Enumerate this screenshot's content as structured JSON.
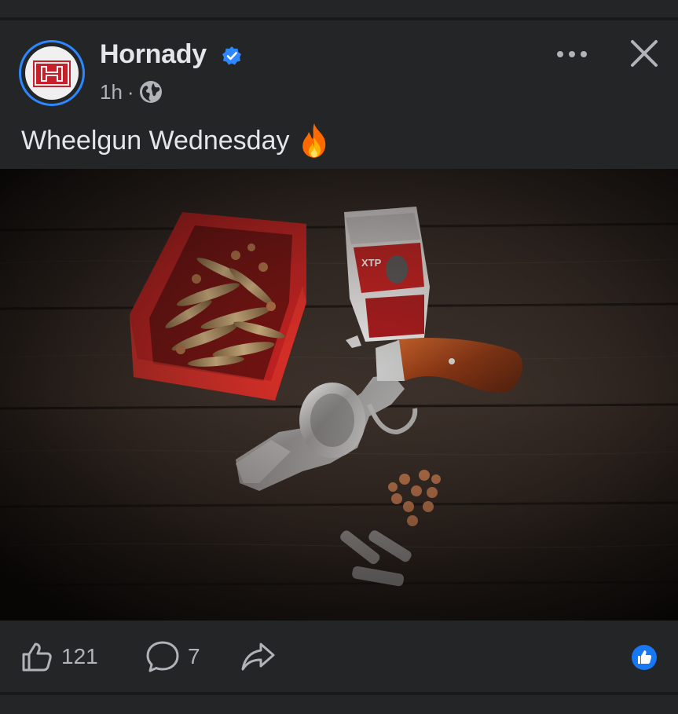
{
  "post": {
    "author": "Hornady",
    "time": "1h",
    "separator": "·",
    "text": "Wheelgun Wednesday",
    "emoji_icon": "fire-icon",
    "privacy_icon": "globe-icon",
    "verified_icon": "verified-badge-icon",
    "photo_alt": "Stainless revolver with wood grip beside a red bin of cartridges, an XTP bullet box and loose bullets on a dark wooden table"
  },
  "header": {
    "more_icon": "more-options-icon",
    "close_icon": "close-icon"
  },
  "actions": {
    "like_count": "121",
    "comment_count": "7",
    "like_icon": "like-icon",
    "comment_icon": "comment-icon",
    "share_icon": "share-icon",
    "reaction_icon": "like-reaction-icon"
  },
  "colors": {
    "background": "#18191a",
    "card": "#242526",
    "primary_text": "#e4e6eb",
    "secondary_text": "#b0b3b8",
    "accent": "#2d88ff",
    "brand_red": "#c8202a"
  }
}
